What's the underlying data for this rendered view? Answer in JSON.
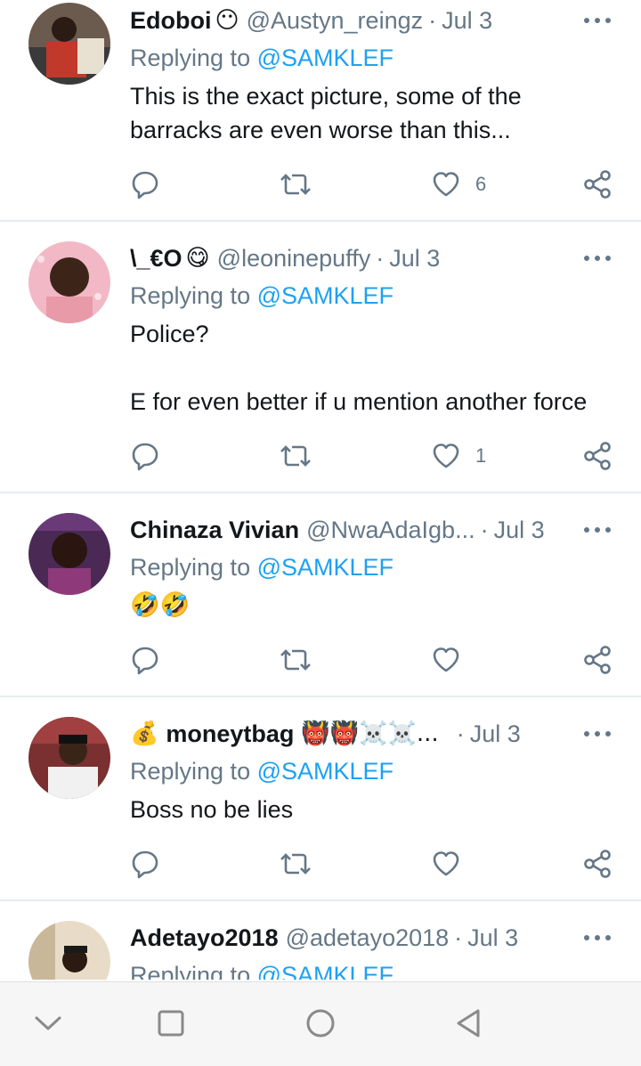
{
  "tweets": [
    {
      "name": "Edoboi",
      "name_emoji": "😶",
      "handle": "@Austyn_reingz",
      "date": "Jul 3",
      "replying_prefix": "Replying to ",
      "replying_to": "@SAMKLEF",
      "text_lines": [
        "This is the exact picture, some of the",
        "barracks are even worse than this..."
      ],
      "likes": "6"
    },
    {
      "name": "\\_€O",
      "name_emoji": "😋",
      "handle": "@leoninepuffy",
      "date": "Jul 3",
      "replying_prefix": "Replying to ",
      "replying_to": "@SAMKLEF",
      "text_lines": [
        "Police?",
        "",
        "E for even better if u mention another force"
      ],
      "likes": "1"
    },
    {
      "name": "Chinaza Vivian",
      "handle": "@NwaAdaIgb...",
      "date": "Jul 3",
      "replying_prefix": "Replying to ",
      "replying_to": "@SAMKLEF",
      "text_lines": [
        "🤣🤣"
      ],
      "likes": ""
    },
    {
      "name_prefix_emoji": "💰",
      "name": "moneytbag",
      "name_suffix_emoji": "👹👹☠️☠️...",
      "date": "Jul 3",
      "replying_prefix": "Replying to ",
      "replying_to": "@SAMKLEF",
      "text_lines": [
        "Boss no be lies"
      ],
      "likes": ""
    },
    {
      "name": "Adetayo2018",
      "handle": "@adetayo2018",
      "date": "Jul 3",
      "replying_prefix": "Replying to ",
      "replying_to": "@SAMKLEF"
    }
  ],
  "separator": "·",
  "icons": {
    "reply": "reply-icon",
    "retweet": "retweet-icon",
    "like": "heart-icon",
    "share": "share-icon",
    "more": "more-icon",
    "nav_back": "chevron-down-icon",
    "nav_recent": "square-icon",
    "nav_home": "circle-icon",
    "nav_return": "triangle-back-icon"
  },
  "colors": {
    "secondary_text": "#657786",
    "mention": "#1da1f2",
    "divider": "#e6ecf0"
  }
}
